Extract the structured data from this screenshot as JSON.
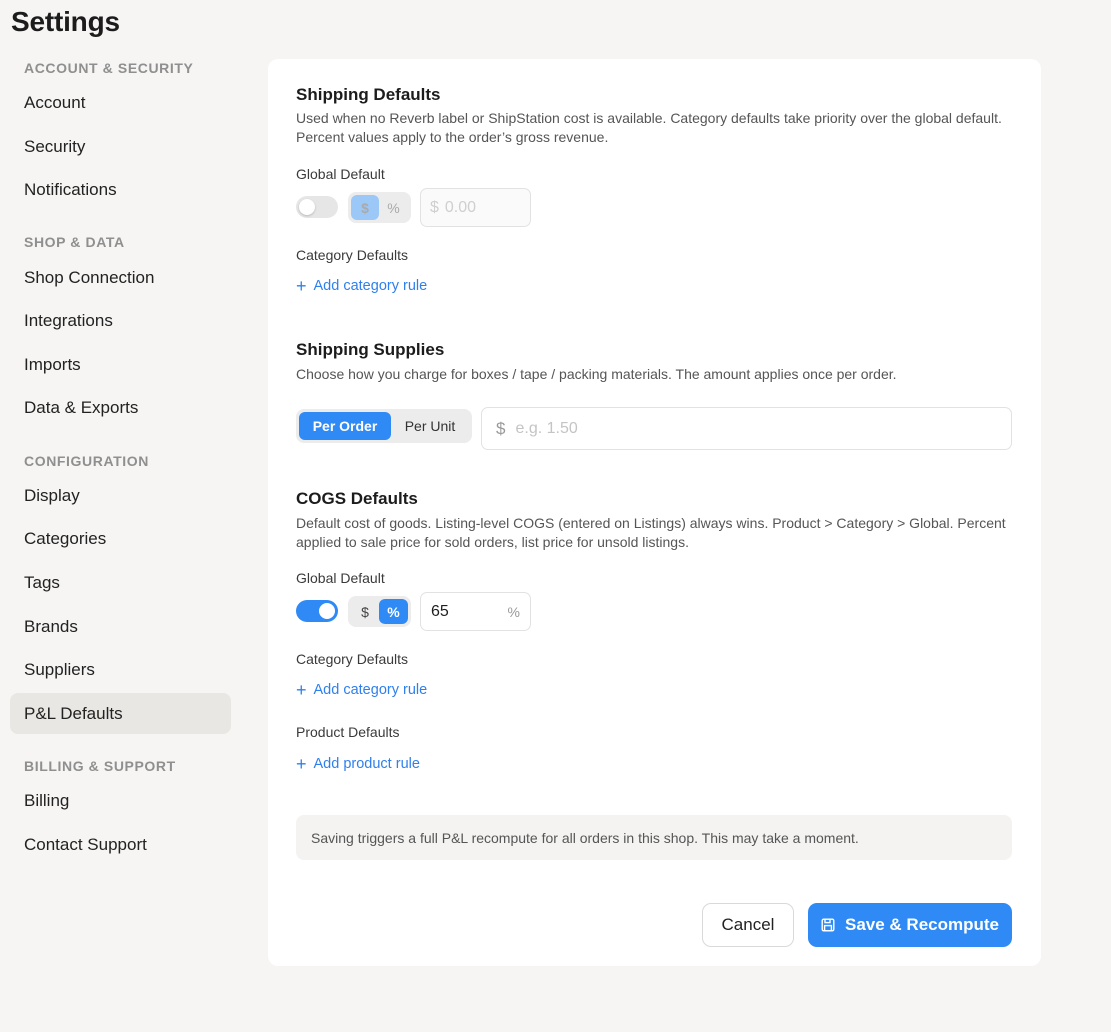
{
  "page": {
    "title": "Settings"
  },
  "sidebar": {
    "sections": [
      {
        "label": "ACCOUNT & SECURITY"
      },
      {
        "label": "SHOP & DATA"
      },
      {
        "label": "CONFIGURATION"
      },
      {
        "label": "BILLING & SUPPORT"
      }
    ],
    "items": [
      {
        "label": "Account"
      },
      {
        "label": "Security"
      },
      {
        "label": "Notifications"
      },
      {
        "label": "Shop Connection"
      },
      {
        "label": "Integrations"
      },
      {
        "label": "Imports"
      },
      {
        "label": "Data & Exports"
      },
      {
        "label": "Display"
      },
      {
        "label": "Categories"
      },
      {
        "label": "Tags"
      },
      {
        "label": "Brands"
      },
      {
        "label": "Suppliers"
      },
      {
        "label": "P&L Defaults",
        "active": true
      },
      {
        "label": "Billing"
      },
      {
        "label": "Contact Support"
      }
    ]
  },
  "shipping_defaults": {
    "title": "Shipping Defaults",
    "description": "Used when no Reverb label or ShipStation cost is available. Category defaults take priority over the global default. Percent values apply to the order’s gross revenue.",
    "global_label": "Global Default",
    "toggle_on": false,
    "mode_dollar": "$",
    "mode_percent": "%",
    "selected_mode": "$",
    "amount_prefix": "$",
    "amount_placeholder": "0.00",
    "category_label": "Category Defaults",
    "add_category": "Add category rule"
  },
  "shipping_supplies": {
    "title": "Shipping Supplies",
    "description": "Choose how you charge for boxes / tape / packing materials. The amount applies once per order.",
    "option_per_order": "Per Order",
    "option_per_unit": "Per Unit",
    "selected": "Per Order",
    "amount_prefix": "$",
    "amount_placeholder": "e.g. 1.50"
  },
  "cogs_defaults": {
    "title": "COGS Defaults",
    "description": "Default cost of goods. Listing-level COGS (entered on Listings) always wins. Product > Category > Global. Percent applied to sale price for sold orders, list price for unsold listings.",
    "global_label": "Global Default",
    "toggle_on": true,
    "mode_dollar": "$",
    "mode_percent": "%",
    "selected_mode": "%",
    "value": "65",
    "value_suffix": "%",
    "category_label": "Category Defaults",
    "add_category": "Add category rule",
    "product_label": "Product Defaults",
    "add_product": "Add product rule"
  },
  "notice": {
    "text": "Saving triggers a full P&L recompute for all orders in this shop. This may take a moment."
  },
  "actions": {
    "cancel": "Cancel",
    "save": "Save & Recompute"
  },
  "colors": {
    "accent": "#2f8af5",
    "link": "#2f80ed",
    "background": "#f6f5f3"
  }
}
